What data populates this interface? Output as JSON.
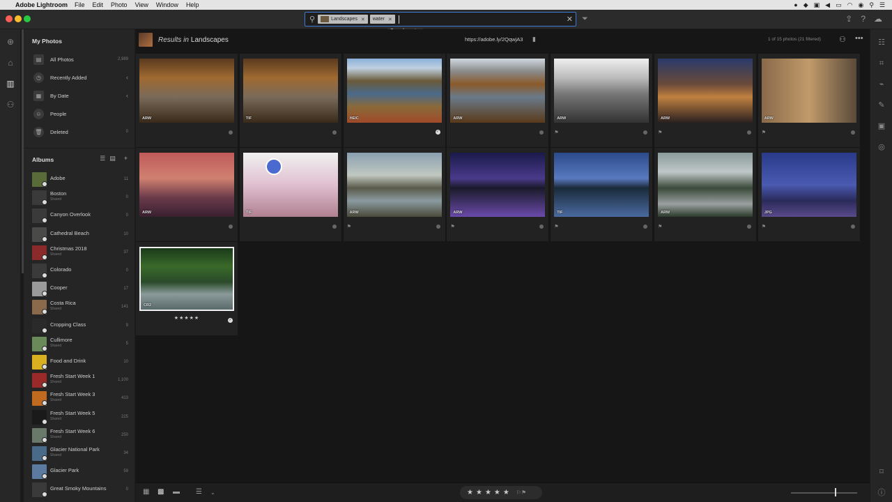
{
  "menubar": {
    "app": "Adobe Lightroom",
    "menus": [
      "File",
      "Edit",
      "Photo",
      "View",
      "Window",
      "Help"
    ]
  },
  "search": {
    "chips": [
      {
        "label": "Landscapes"
      },
      {
        "label": "water"
      }
    ],
    "tooltip": "Search: water"
  },
  "sidebar": {
    "my_photos_title": "My Photos",
    "nav": [
      {
        "label": "All Photos",
        "count": "2,989",
        "icon": "photos-icon"
      },
      {
        "label": "Recently Added",
        "icon": "clock-icon",
        "chevron": "‹"
      },
      {
        "label": "By Date",
        "icon": "calendar-icon",
        "chevron": "‹"
      },
      {
        "label": "People",
        "icon": "person-icon"
      },
      {
        "label": "Deleted",
        "count": "0",
        "icon": "trash-icon"
      }
    ],
    "albums_title": "Albums",
    "albums": [
      {
        "name": "Adobe",
        "count": "11",
        "shared": false,
        "color": "#5a6b3a"
      },
      {
        "name": "Boston",
        "count": "0",
        "shared": true,
        "sublabel": "Shared",
        "color": "#3a3a3a"
      },
      {
        "name": "Canyon Overlook",
        "count": "0",
        "shared": false,
        "color": "#3a3a3a"
      },
      {
        "name": "Cathedral Beach",
        "count": "10",
        "shared": false,
        "color": "#4a4a48"
      },
      {
        "name": "Christmas 2018",
        "count": "37",
        "shared": true,
        "sublabel": "Shared",
        "color": "#8a2a2a"
      },
      {
        "name": "Colorado",
        "count": "0",
        "shared": false,
        "color": "#3a3a3a"
      },
      {
        "name": "Cooper",
        "count": "17",
        "shared": false,
        "color": "#9a9a9a"
      },
      {
        "name": "Costa Rica",
        "count": "141",
        "shared": true,
        "sublabel": "Shared",
        "color": "#8a6a4a"
      },
      {
        "name": "Cropping Class",
        "count": "9",
        "shared": false,
        "color": "#2a2a2a"
      },
      {
        "name": "Cullimore",
        "count": "5",
        "shared": true,
        "sublabel": "Shared",
        "color": "#6a8a5a"
      },
      {
        "name": "Food and Drink",
        "count": "10",
        "shared": false,
        "color": "#d8b020"
      },
      {
        "name": "Fresh Start Week 1",
        "count": "1,100",
        "shared": true,
        "sublabel": "Shared",
        "color": "#9a2a2a"
      },
      {
        "name": "Fresh Start Week 3",
        "count": "413",
        "shared": true,
        "sublabel": "Shared",
        "color": "#c06a20"
      },
      {
        "name": "Fresh Start Week 5",
        "count": "225",
        "shared": true,
        "sublabel": "Shared",
        "color": "#1a1a1a"
      },
      {
        "name": "Fresh Start Week 6",
        "count": "250",
        "shared": true,
        "sublabel": "Shared",
        "color": "#6a7a6a"
      },
      {
        "name": "Glacier National Park",
        "count": "34",
        "shared": true,
        "sublabel": "Shared",
        "color": "#4a6a8a"
      },
      {
        "name": "Glacier Park",
        "count": "59",
        "shared": false,
        "color": "#5a7aa0"
      },
      {
        "name": "Great Smoky Mountains",
        "count": "0",
        "shared": false,
        "color": "#3a3a3a"
      }
    ]
  },
  "main": {
    "results_prefix": "Results in",
    "results_album": "Landscapes",
    "share_url": "https://adobe.ly/2QqwjA3",
    "count_text": "1 of 15 photos  (21 filtered)"
  },
  "grid": [
    {
      "format": "ARW",
      "status": "dot",
      "flag": false,
      "bg": "linear-gradient(180deg,#5a3a20 0%,#a06a30 30%,#7a6a5a 60%,#3a2a1a 100%)"
    },
    {
      "format": "TIF",
      "status": "dot",
      "flag": false,
      "bg": "linear-gradient(180deg,#5a3a20 0%,#a06a30 30%,#7a6a5a 60%,#3a2a1a 100%)"
    },
    {
      "format": "HEIC",
      "status": "check",
      "flag": false,
      "bg": "linear-gradient(180deg,#8ab0d8 0%,#c0d0e0 15%,#6a5a3a 35%,#4a6a8a 55%,#8a6a3a 75%,#a04a2a 100%)"
    },
    {
      "format": "ARW",
      "status": "dot",
      "flag": false,
      "bg": "linear-gradient(180deg,#d0d8e0 0%,#8a8a8a 20%,#8a5a2a 40%,#6a7a8a 60%,#5a3a1a 100%)"
    },
    {
      "format": "ARW",
      "status": "dot",
      "flag": true,
      "bg": "linear-gradient(180deg,#eeeeee 0%,#bbbbbb 30%,#777777 55%,#333333 100%)"
    },
    {
      "format": "ARW",
      "status": "dot",
      "flag": true,
      "bg": "linear-gradient(180deg,#2a3a6a 0%,#6a4a3a 40%,#c08040 60%,#2a2020 100%)"
    },
    {
      "format": "ARW",
      "status": "dot",
      "flag": true,
      "bg": "linear-gradient(90deg,#8a6a4a 0%,#c09a6a 50%,#5a4a3a 100%)"
    },
    {
      "format": "ARW",
      "status": "dot",
      "flag": false,
      "bg": "linear-gradient(180deg,#c05a5a 0%,#d08070 40%,#6a3a4a 70%,#3a2030 100%)"
    },
    {
      "format": "TIF",
      "status": "dot",
      "flag": false,
      "bg": "linear-gradient(180deg,#f0f0f0 0%,#e0c0d0 50%,#b08090 100%)",
      "logo": true
    },
    {
      "format": "ARW",
      "status": "dot",
      "flag": true,
      "bg": "linear-gradient(180deg,#8aa0b0 0%,#c0c8c0 35%,#5a5a4a 55%,#8a9aa0 75%,#4a4a3a 100%)"
    },
    {
      "format": "ARW",
      "status": "dot",
      "flag": true,
      "bg": "linear-gradient(180deg,#1a1a4a 0%,#4a3a8a 40%,#1a1a2a 55%,#6a4aaa 100%)"
    },
    {
      "format": "TIF",
      "status": "dot",
      "flag": true,
      "bg": "linear-gradient(180deg,#2a4a8a 0%,#5a7ac0 40%,#1a2a3a 55%,#4a6aa0 100%)"
    },
    {
      "format": "ARW",
      "status": "dot",
      "flag": true,
      "bg": "linear-gradient(180deg,#8a9a9a 0%,#c0c8c8 30%,#3a4a3a 55%,#9aa0a0 80%,#2a3a2a 100%)"
    },
    {
      "format": "JPG",
      "status": "dot",
      "flag": true,
      "bg": "linear-gradient(180deg,#2a3a8a 0%,#4a5ab0 50%,#2a2a5a 75%,#5a4a8a 100%)"
    },
    {
      "format": "CR2",
      "status": "check",
      "flag": false,
      "selected": true,
      "stars": "★★★★★",
      "bg": "linear-gradient(180deg,#1a3a1a 0%,#3a6a2a 30%,#2a4a2a 55%,#8a9a9a 75%,#5a6a6a 100%)"
    }
  ],
  "bottom": {
    "stars": [
      "★",
      "★",
      "★",
      "★",
      "★"
    ],
    "flags": "⚐⚑"
  },
  "icons": {
    "apple": "",
    "search": "⚲",
    "close": "✕",
    "filter": "⏷"
  }
}
